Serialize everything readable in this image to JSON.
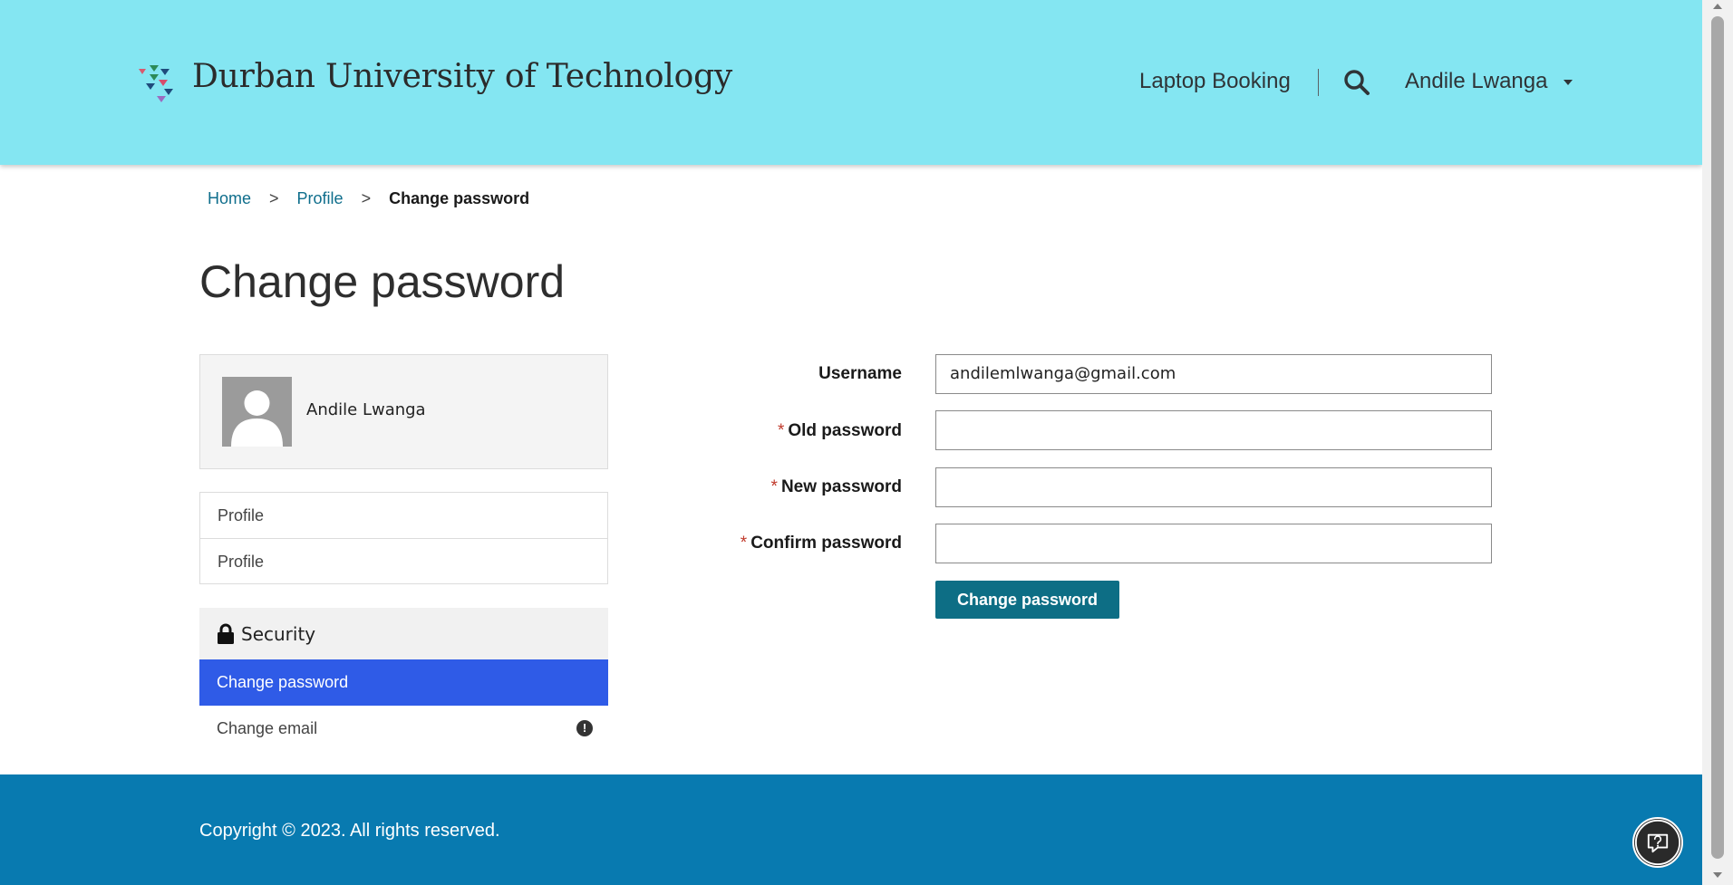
{
  "header": {
    "brand": "Durban University of Technology",
    "nav_link": "Laptop Booking",
    "user_name": "Andile Lwanga"
  },
  "breadcrumb": {
    "home": "Home",
    "sep": ">",
    "profile": "Profile",
    "current": "Change password"
  },
  "page_title": "Change password",
  "sidebar": {
    "user_name": "Andile Lwanga",
    "items": [
      "Profile",
      "Profile"
    ],
    "security_title": "Security",
    "active_item": "Change password",
    "other_item": "Change email",
    "info_symbol": "!"
  },
  "form": {
    "username_label": "Username",
    "username_value": "andilemlwanga@gmail.com",
    "required_mark": "*",
    "old_password_label": "Old password",
    "new_password_label": "New password",
    "confirm_password_label": "Confirm password",
    "submit_label": "Change password"
  },
  "footer": {
    "copyright": "Copyright © 2023. All rights reserved."
  },
  "colors": {
    "header_bg": "#84e6f2",
    "footer_bg": "#087ab0",
    "active_bg": "#2f5be7",
    "button_bg": "#0d6e85",
    "link": "#0f6e8c"
  },
  "icons": {
    "logo": "dut-logo-icon",
    "search": "search-icon",
    "caret": "caret-down-icon",
    "lock": "lock-icon",
    "info": "info-icon",
    "help": "help-chat-icon"
  }
}
